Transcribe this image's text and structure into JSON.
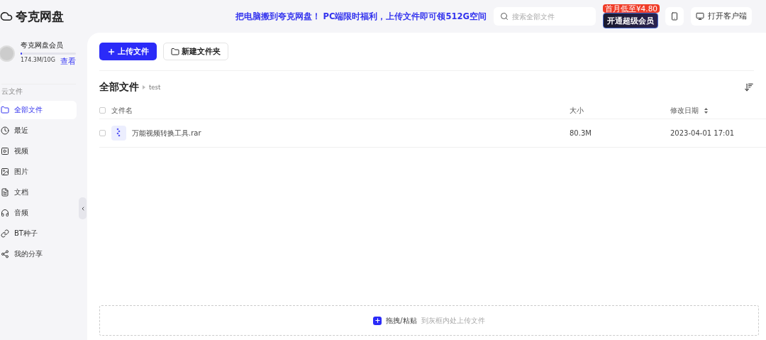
{
  "app": {
    "name": "夸克网盘"
  },
  "promo": {
    "text": "把电脑搬到夸克网盘！ PC端限时福利，上传文件即可领512G空间"
  },
  "search": {
    "placeholder": "搜索全部文件"
  },
  "vip_button": {
    "label": "开通超级会员",
    "badge": "首月低至¥4.80"
  },
  "client_button": {
    "label": "打开客户端"
  },
  "user": {
    "name": "夸克网盘会员",
    "usage": "174.3M/10G",
    "level": 0.02,
    "link": "查看"
  },
  "sidebar": {
    "section": "云文件",
    "items": [
      {
        "label": "全部文件",
        "selected": true
      },
      {
        "label": "最近",
        "selected": false
      },
      {
        "label": "视频",
        "selected": false
      },
      {
        "label": "图片",
        "selected": false
      },
      {
        "label": "文档",
        "selected": false
      },
      {
        "label": "音频",
        "selected": false
      },
      {
        "label": "BT种子",
        "selected": false
      },
      {
        "label": "我的分享",
        "selected": false
      }
    ]
  },
  "toolbar": {
    "upload": "上传文件",
    "new_folder": "新建文件夹"
  },
  "breadcrumb": {
    "root": "全部文件",
    "current": "test"
  },
  "table": {
    "select_all_checked": false,
    "columns": [
      "文件名",
      "大小",
      "修改日期"
    ],
    "rows": [
      {
        "name": "万能视频转换工具.rar",
        "size": "80.3M",
        "date": "2023-04-01 17:01",
        "checked": false
      }
    ]
  },
  "dropzone": {
    "action": "拖拽/粘贴",
    "hint": "到灰框内处上传文件"
  }
}
